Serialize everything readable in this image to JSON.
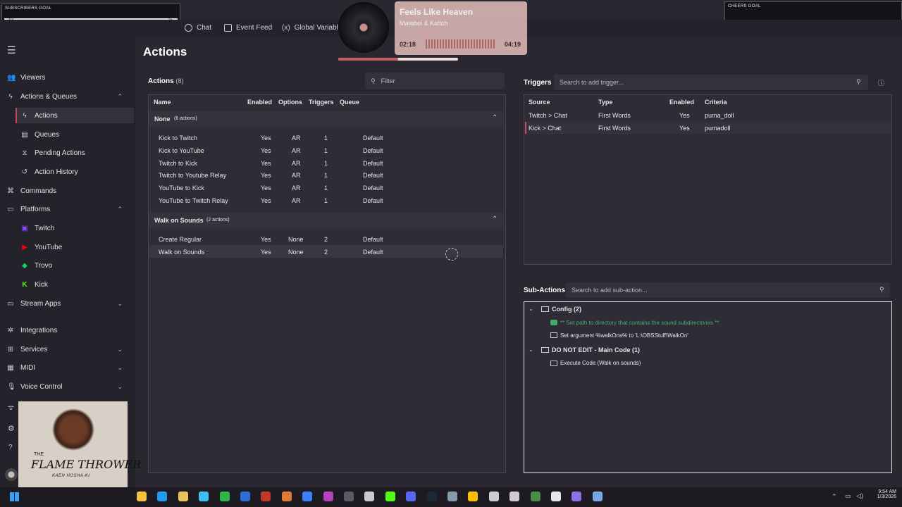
{
  "overlay": {
    "sub_goal_title": "SUBSCRIBERS GOAL",
    "sub_goal_left": "2/3",
    "sub_goal_right": "15",
    "cheers_goal_title": "CHEERS GOAL"
  },
  "topnav": {
    "chat": "Chat",
    "event_feed": "Event Feed",
    "global_variables": "Global Variables"
  },
  "now_playing": {
    "title": "Feels Like Heaven",
    "artist": "Matabei & Kattch",
    "elapsed": "02:18",
    "total": "04:19",
    "progress": 0.5
  },
  "page": {
    "title": "Actions"
  },
  "sidebar": {
    "items": [
      {
        "label": "Viewers"
      },
      {
        "label": "Actions & Queues"
      },
      {
        "label": "Actions"
      },
      {
        "label": "Queues"
      },
      {
        "label": "Pending Actions"
      },
      {
        "label": "Action History"
      },
      {
        "label": "Commands"
      },
      {
        "label": "Platforms"
      },
      {
        "label": "Twitch"
      },
      {
        "label": "YouTube"
      },
      {
        "label": "Trovo"
      },
      {
        "label": "Kick"
      },
      {
        "label": "Stream Apps"
      },
      {
        "label": "Integrations"
      },
      {
        "label": "Services"
      },
      {
        "label": "MIDI"
      },
      {
        "label": "Voice Control"
      }
    ]
  },
  "actions_panel": {
    "title": "Actions",
    "count": "(8)",
    "filter_placeholder": "Filter",
    "columns": [
      "Name",
      "Enabled",
      "Options",
      "Triggers",
      "Queue"
    ],
    "groups": [
      {
        "name": "None",
        "meta": "(6 actions)",
        "rows": [
          {
            "name": "Kick to Twitch",
            "enabled": "Yes",
            "options": "AR",
            "triggers": "1",
            "queue": "Default"
          },
          {
            "name": "Kick to YouTube",
            "enabled": "Yes",
            "options": "AR",
            "triggers": "1",
            "queue": "Default"
          },
          {
            "name": "Twitch to Kick",
            "enabled": "Yes",
            "options": "AR",
            "triggers": "1",
            "queue": "Default"
          },
          {
            "name": "Twitch to Youtube Relay",
            "enabled": "Yes",
            "options": "AR",
            "triggers": "1",
            "queue": "Default"
          },
          {
            "name": "YouTube to Kick",
            "enabled": "Yes",
            "options": "AR",
            "triggers": "1",
            "queue": "Default"
          },
          {
            "name": "YouTube to Twitch Relay",
            "enabled": "Yes",
            "options": "AR",
            "triggers": "1",
            "queue": "Default"
          }
        ]
      },
      {
        "name": "Walk on Sounds",
        "meta": "(2 actions)",
        "rows": [
          {
            "name": "Create Regular",
            "enabled": "Yes",
            "options": "None",
            "triggers": "2",
            "queue": "Default"
          },
          {
            "name": "Walk on Sounds",
            "enabled": "Yes",
            "options": "None",
            "triggers": "2",
            "queue": "Default"
          }
        ]
      }
    ]
  },
  "triggers_panel": {
    "title": "Triggers",
    "search_placeholder": "Search to add trigger...",
    "columns": [
      "Source",
      "Type",
      "Enabled",
      "Criteria"
    ],
    "rows": [
      {
        "source": "Twitch > Chat",
        "type": "First Words",
        "enabled": "Yes",
        "criteria": "puma_doll"
      },
      {
        "source": "Kick > Chat",
        "type": "First Words",
        "enabled": "Yes",
        "criteria": "pumadoll"
      }
    ]
  },
  "subactions_panel": {
    "title": "Sub-Actions",
    "search_placeholder": "Search to add sub-action...",
    "tree": {
      "config_group": "Config (2)",
      "comment": "** Set path to directory that contains the sound subdirectories **",
      "set_argument": "Set argument %walkOns% to 'L:\\OBSStuff\\WalkOn'",
      "main_group": "DO NOT EDIT - Main Code (1)",
      "execute": "Execute Code (Walk on sounds)"
    }
  },
  "webcam": {
    "logo_line1": "THE",
    "logo_line2": "FLAME THROWER",
    "logo_line3": "KAEN HOSHA-KI"
  },
  "taskbar": {
    "time": "9:54 AM",
    "date": "1/3/2026"
  },
  "colors": {
    "accent": "#c94a5c",
    "comment_green": "#3fae6a",
    "kick_green": "#53fc18",
    "youtube_red": "#ff0000"
  }
}
